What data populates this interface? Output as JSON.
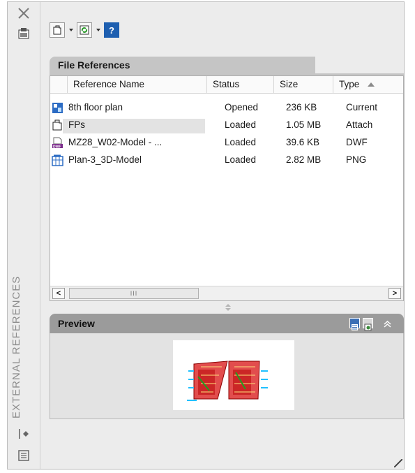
{
  "palette": {
    "vertical_title": "EXTERNAL REFERENCES"
  },
  "toolbar": {
    "buttons": [
      "attach-icon",
      "refresh-icon",
      "help-icon"
    ]
  },
  "file_references": {
    "title": "File References",
    "columns": [
      "Reference Name",
      "Status",
      "Size",
      "Type"
    ],
    "rows": [
      {
        "name": "8th floor plan",
        "status": "Opened",
        "size": "236 KB",
        "type": "Current",
        "icon": "current-drawing-icon"
      },
      {
        "name": "FPs",
        "status": "Loaded",
        "size": "1.05 MB",
        "type": "Attach",
        "icon": "dwg-xref-icon"
      },
      {
        "name": "MZ28_W02-Model - ...",
        "status": "Loaded",
        "size": "39.6 KB",
        "type": "DWF",
        "icon": "dwf-file-icon"
      },
      {
        "name": "Plan-3_3D-Model",
        "status": "Loaded",
        "size": "2.82 MB",
        "type": "PNG",
        "icon": "image-file-icon"
      }
    ],
    "scroll_thumb_grip": "III"
  },
  "preview": {
    "title": "Preview"
  },
  "colors": {
    "header_tab": "#c5c5c5",
    "preview_header": "#9b9b9b",
    "accent_blue": "#1e5fb0"
  }
}
